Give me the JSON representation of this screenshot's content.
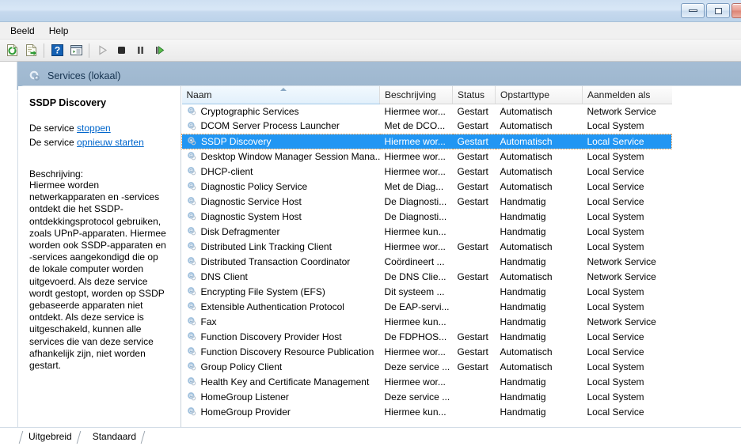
{
  "window": {
    "titlebar_buttons": [
      {
        "name": "minimize",
        "label": ""
      },
      {
        "name": "restore",
        "label": ""
      },
      {
        "name": "close",
        "label": ""
      }
    ]
  },
  "menubar": {
    "items": [
      {
        "label": "Beeld"
      },
      {
        "label": "Help"
      }
    ]
  },
  "toolbar": {
    "buttons": [
      {
        "name": "refresh-icon",
        "title": "Vernieuwen"
      },
      {
        "name": "export-list-icon",
        "title": "Lijst exporteren"
      },
      {
        "name": "help-icon",
        "title": "Help"
      },
      {
        "name": "properties-icon",
        "title": "Eigenschappen"
      },
      {
        "name": "start-service-icon",
        "title": "Start"
      },
      {
        "name": "stop-service-icon",
        "title": "Stoppen"
      },
      {
        "name": "pause-service-icon",
        "title": "Onderbreken"
      },
      {
        "name": "restart-service-icon",
        "title": "Opnieuw starten"
      }
    ]
  },
  "console": {
    "root_label": "Services (lokaal)"
  },
  "details": {
    "service_name": "SSDP Discovery",
    "action_prefix_1": "De service",
    "action_link_1": "stoppen",
    "action_prefix_2": "De service",
    "action_link_2": "opnieuw starten",
    "description_label": "Beschrijving:",
    "description_text": "Hiermee worden netwerkapparaten en -services ontdekt die het SSDP-ontdekkingsprotocol gebruiken, zoals UPnP-apparaten. Hiermee worden ook SSDP-apparaten en -services aangekondigd die op de lokale computer worden uitgevoerd. Als deze service wordt gestopt, worden op SSDP gebaseerde apparaten niet ontdekt. Als deze service is uitgeschakeld, kunnen alle services die van deze service afhankelijk zijn, niet worden gestart."
  },
  "table": {
    "columns": [
      {
        "key": "name",
        "label": "Naam",
        "sorted": true
      },
      {
        "key": "description",
        "label": "Beschrijving",
        "sorted": false
      },
      {
        "key": "status",
        "label": "Status",
        "sorted": false
      },
      {
        "key": "startup",
        "label": "Opstarttype",
        "sorted": false
      },
      {
        "key": "logon",
        "label": "Aanmelden als",
        "sorted": false
      }
    ],
    "selected_index": 2,
    "rows": [
      {
        "name": "Cryptographic Services",
        "description": "Hiermee wor...",
        "status": "Gestart",
        "startup": "Automatisch",
        "logon": "Network Service"
      },
      {
        "name": "DCOM Server Process Launcher",
        "description": "Met de DCO...",
        "status": "Gestart",
        "startup": "Automatisch",
        "logon": "Local System"
      },
      {
        "name": "SSDP Discovery",
        "description": "Hiermee wor...",
        "status": "Gestart",
        "startup": "Automatisch",
        "logon": "Local Service"
      },
      {
        "name": "Desktop Window Manager Session Mana...",
        "description": "Hiermee wor...",
        "status": "Gestart",
        "startup": "Automatisch",
        "logon": "Local System"
      },
      {
        "name": "DHCP-client",
        "description": "Hiermee wor...",
        "status": "Gestart",
        "startup": "Automatisch",
        "logon": "Local Service"
      },
      {
        "name": "Diagnostic Policy Service",
        "description": "Met de Diag...",
        "status": "Gestart",
        "startup": "Automatisch",
        "logon": "Local Service"
      },
      {
        "name": "Diagnostic Service Host",
        "description": "De Diagnosti...",
        "status": "Gestart",
        "startup": "Handmatig",
        "logon": "Local Service"
      },
      {
        "name": "Diagnostic System Host",
        "description": "De Diagnosti...",
        "status": "",
        "startup": "Handmatig",
        "logon": "Local System"
      },
      {
        "name": "Disk Defragmenter",
        "description": "Hiermee kun...",
        "status": "",
        "startup": "Handmatig",
        "logon": "Local System"
      },
      {
        "name": "Distributed Link Tracking Client",
        "description": "Hiermee wor...",
        "status": "Gestart",
        "startup": "Automatisch",
        "logon": "Local System"
      },
      {
        "name": "Distributed Transaction Coordinator",
        "description": "Coördineert ...",
        "status": "",
        "startup": "Handmatig",
        "logon": "Network Service"
      },
      {
        "name": "DNS Client",
        "description": "De DNS Clie...",
        "status": "Gestart",
        "startup": "Automatisch",
        "logon": "Network Service"
      },
      {
        "name": "Encrypting File System (EFS)",
        "description": "Dit systeem ...",
        "status": "",
        "startup": "Handmatig",
        "logon": "Local System"
      },
      {
        "name": "Extensible Authentication Protocol",
        "description": "De EAP-servi...",
        "status": "",
        "startup": "Handmatig",
        "logon": "Local System"
      },
      {
        "name": "Fax",
        "description": "Hiermee kun...",
        "status": "",
        "startup": "Handmatig",
        "logon": "Network Service"
      },
      {
        "name": "Function Discovery Provider Host",
        "description": "De FDPHOS...",
        "status": "Gestart",
        "startup": "Handmatig",
        "logon": "Local Service"
      },
      {
        "name": "Function Discovery Resource Publication",
        "description": "Hiermee wor...",
        "status": "Gestart",
        "startup": "Automatisch",
        "logon": "Local Service"
      },
      {
        "name": "Group Policy Client",
        "description": "Deze service ...",
        "status": "Gestart",
        "startup": "Automatisch",
        "logon": "Local System"
      },
      {
        "name": "Health Key and Certificate Management",
        "description": "Hiermee wor...",
        "status": "",
        "startup": "Handmatig",
        "logon": "Local System"
      },
      {
        "name": "HomeGroup Listener",
        "description": "Deze service ...",
        "status": "",
        "startup": "Handmatig",
        "logon": "Local System"
      },
      {
        "name": "HomeGroup Provider",
        "description": "Hiermee kun...",
        "status": "",
        "startup": "Handmatig",
        "logon": "Local Service"
      }
    ]
  },
  "tabs": {
    "items": [
      {
        "label": "Uitgebreid",
        "active": false
      },
      {
        "label": "Standaard",
        "active": true
      }
    ]
  },
  "colors": {
    "selection": "#2196f3",
    "header_band": "#9cb5ce",
    "link": "#0066cc"
  }
}
